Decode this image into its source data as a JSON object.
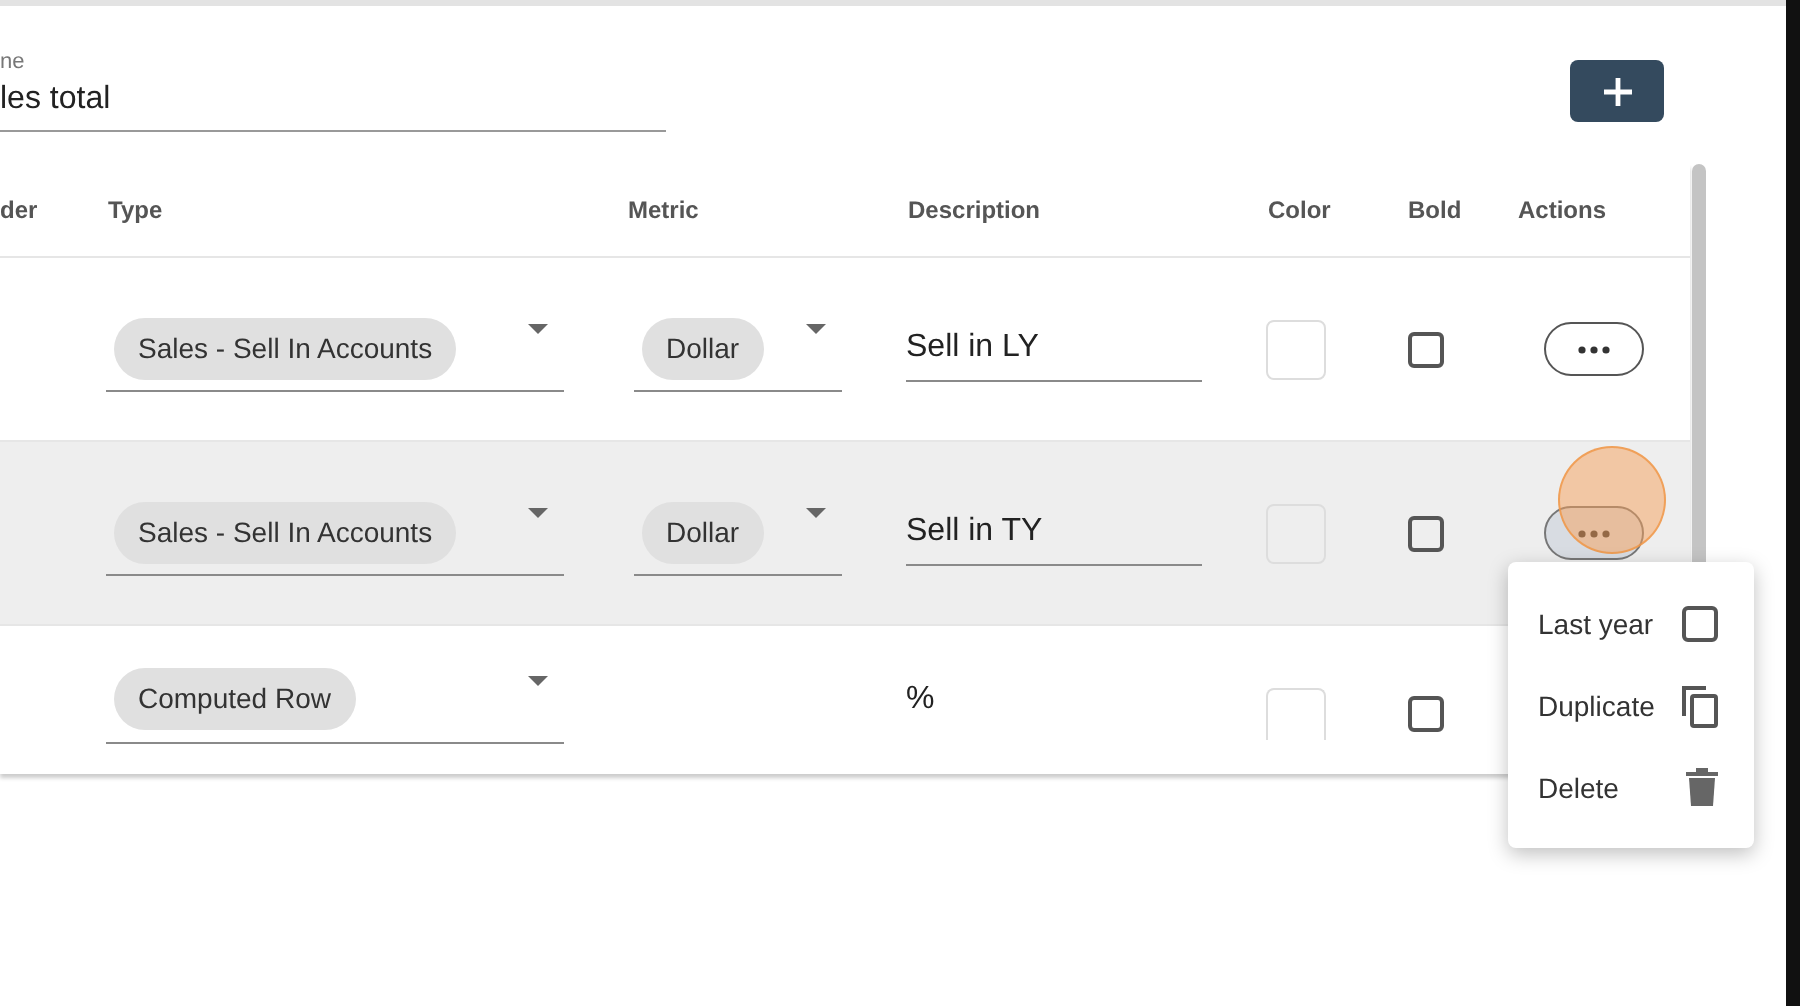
{
  "name_field": {
    "label": "ne",
    "value": "les total"
  },
  "table": {
    "columns": [
      "der",
      "Type",
      "Metric",
      "Description",
      "Color",
      "Bold",
      "Actions"
    ],
    "rows": [
      {
        "type": "Sales - Sell In Accounts",
        "metric": "Dollar",
        "description": {
          "kind": "field",
          "text": "Sell in LY"
        },
        "bold": false,
        "highlighted": false,
        "actions_visible": true
      },
      {
        "type": "Sales - Sell In Accounts",
        "metric": "Dollar",
        "description": {
          "kind": "field",
          "text": "Sell in TY"
        },
        "bold": false,
        "highlighted": true,
        "actions_visible": true
      },
      {
        "type": "Computed Row",
        "description": {
          "kind": "text",
          "text": "%"
        },
        "bold": false,
        "highlighted": false
      }
    ]
  },
  "menu": {
    "items": [
      {
        "label": "Last year",
        "kind": "checkbox",
        "checked": false
      },
      {
        "label": "Duplicate",
        "kind": "copy"
      },
      {
        "label": "Delete",
        "kind": "delete"
      }
    ]
  }
}
